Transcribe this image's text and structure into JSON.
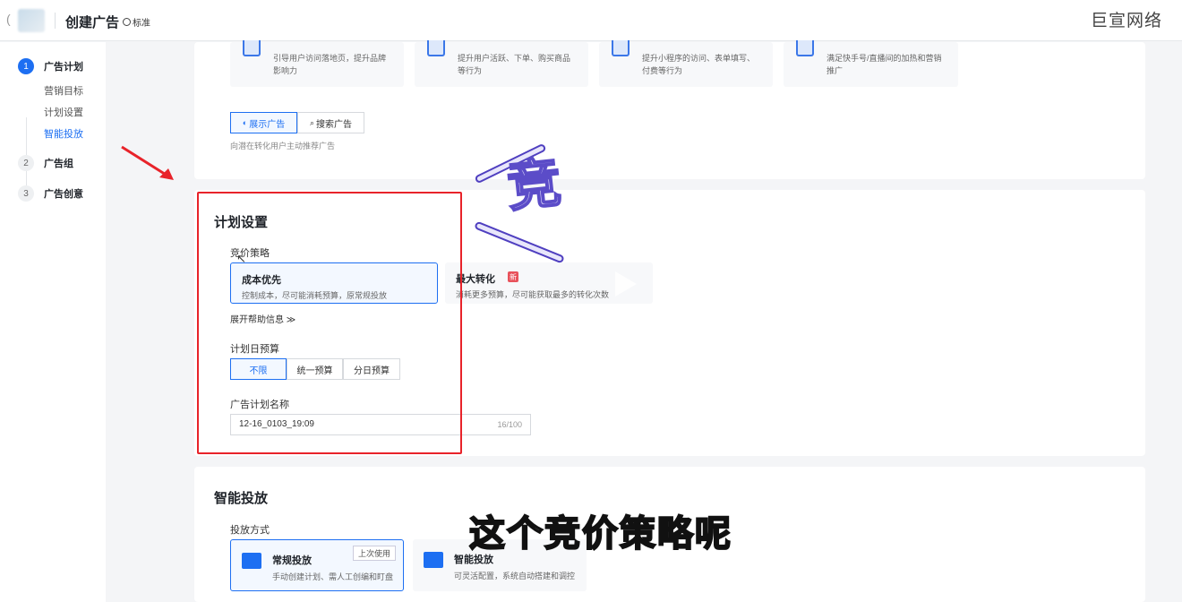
{
  "header": {
    "paren": "(",
    "title": "创建广告",
    "badge": "标准",
    "watermark": "巨宣网络"
  },
  "sidebar": {
    "steps": [
      {
        "num": "1",
        "label": "广告计划"
      },
      {
        "num": "2",
        "label": "广告组"
      },
      {
        "num": "3",
        "label": "广告创意"
      }
    ],
    "substeps": [
      "营销目标",
      "计划设置",
      "智能投放"
    ]
  },
  "targets": [
    {
      "desc": "引导用户访问落地页，提升品牌影响力"
    },
    {
      "desc": "提升用户活跃、下单、购买商品等行为"
    },
    {
      "desc": "提升小程序的访问、表单填写、付费等行为"
    },
    {
      "desc": "满足快手号/直播间的加热和营销推广"
    }
  ],
  "ad_type": {
    "options": [
      "展示广告",
      "搜索广告"
    ],
    "selected": "展示广告",
    "hint": "向潜在转化用户主动推荐广告"
  },
  "plan_settings": {
    "title": "计划设置",
    "bid_strategy_label": "竞价策略",
    "strategies": [
      {
        "title": "成本优先",
        "desc": "控制成本，尽可能消耗预算，原常规投放",
        "selected": true
      },
      {
        "title": "最大转化",
        "badge": "新",
        "desc": "消耗更多预算，尽可能获取最多的转化次数",
        "selected": false
      }
    ],
    "expand_help": "展开帮助信息 ≫",
    "budget_label": "计划日预算",
    "budget_options": [
      "不限",
      "统一预算",
      "分日预算"
    ],
    "budget_selected": "不限",
    "name_label": "广告计划名称",
    "name_value": "12-16_0103_19:09",
    "name_counter": "16/100"
  },
  "smart_delivery": {
    "title": "智能投放",
    "mode_label": "投放方式",
    "modes": [
      {
        "title": "常规投放",
        "tag": "上次使用",
        "desc": "手动创建计划、需人工创编和盯盘"
      },
      {
        "title": "智能投放",
        "desc": "可灵活配置，系统自动搭建和调控"
      }
    ]
  },
  "overlay": {
    "sticker": "竞",
    "caption": "这个竞价策略呢"
  },
  "colors": {
    "accent": "#1d6ff2",
    "highlight_box": "#e8232a"
  }
}
